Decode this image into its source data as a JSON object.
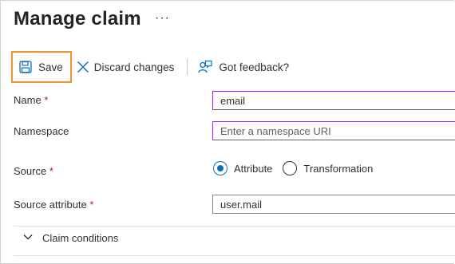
{
  "header": {
    "title": "Manage claim",
    "more_label": "···"
  },
  "toolbar": {
    "save_label": "Save",
    "discard_label": "Discard changes",
    "feedback_label": "Got feedback?"
  },
  "form": {
    "name": {
      "label": "Name",
      "required": "*",
      "value": "email"
    },
    "namespace": {
      "label": "Namespace",
      "placeholder": "Enter a namespace URI",
      "value": ""
    },
    "source": {
      "label": "Source",
      "required": "*",
      "options": [
        {
          "label": "Attribute",
          "selected": true
        },
        {
          "label": "Transformation",
          "selected": false
        }
      ]
    },
    "source_attribute": {
      "label": "Source attribute",
      "required": "*",
      "value": "user.mail"
    }
  },
  "claim_conditions": {
    "label": "Claim conditions",
    "expanded": false
  },
  "colors": {
    "accent": "#0f6cbd",
    "focus_outline": "#f0922c",
    "required": "#a4262c",
    "input_focus": "#8a3ab3"
  },
  "icons": [
    "more-icon",
    "save-icon",
    "close-icon",
    "feedback-icon",
    "chevron-down-icon"
  ]
}
